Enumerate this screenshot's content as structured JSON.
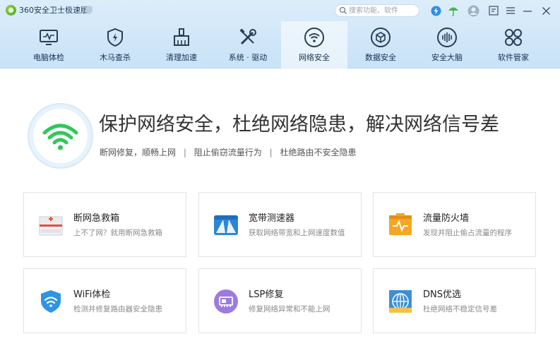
{
  "app": {
    "title": "360安全卫士极速版"
  },
  "search": {
    "placeholder": "搜索功能、软件"
  },
  "colors": {
    "accent": "#1a7fd4",
    "header_bg": "#cfe5f8",
    "wifi_green": "#2fc85a"
  },
  "nav": {
    "items": [
      {
        "label": "电脑体检",
        "icon": "monitor-pulse-icon"
      },
      {
        "label": "木马查杀",
        "icon": "shield-bolt-icon"
      },
      {
        "label": "清理加速",
        "icon": "broom-icon"
      },
      {
        "label": "系统 · 驱动",
        "icon": "wrench-icon"
      },
      {
        "label": "网络安全",
        "icon": "wifi-circle-icon"
      },
      {
        "label": "数据安全",
        "icon": "cube-icon"
      },
      {
        "label": "安全大脑",
        "icon": "brain-icon"
      },
      {
        "label": "软件管家",
        "icon": "apps-icon"
      }
    ],
    "active": "网络安全"
  },
  "hero": {
    "title": "保护网络安全，杜绝网络隐患，解决网络信号差",
    "sub1": "断网修复，顺畅上网",
    "sub2": "阻止偷窃流量行为",
    "sub3": "杜绝路由不安全隐患",
    "separator": "|"
  },
  "cards": [
    {
      "title": "断网急救箱",
      "desc": "上不了网？就用断网急救箱",
      "icon": "first-aid-kit-icon"
    },
    {
      "title": "宽带测速器",
      "desc": "获取网络带宽和上网速度数值",
      "icon": "speedometer-icon"
    },
    {
      "title": "流量防火墙",
      "desc": "发现并阻止偷占流量的程序",
      "icon": "firewall-icon"
    },
    {
      "title": "WiFi体检",
      "desc": "检测并修复路由器安全隐患",
      "icon": "wifi-shield-icon"
    },
    {
      "title": "LSP修复",
      "desc": "修复网络异常和不能上网",
      "icon": "network-card-icon"
    },
    {
      "title": "DNS优选",
      "desc": "杜绝网络不稳定信号差",
      "icon": "globe-icon"
    }
  ]
}
